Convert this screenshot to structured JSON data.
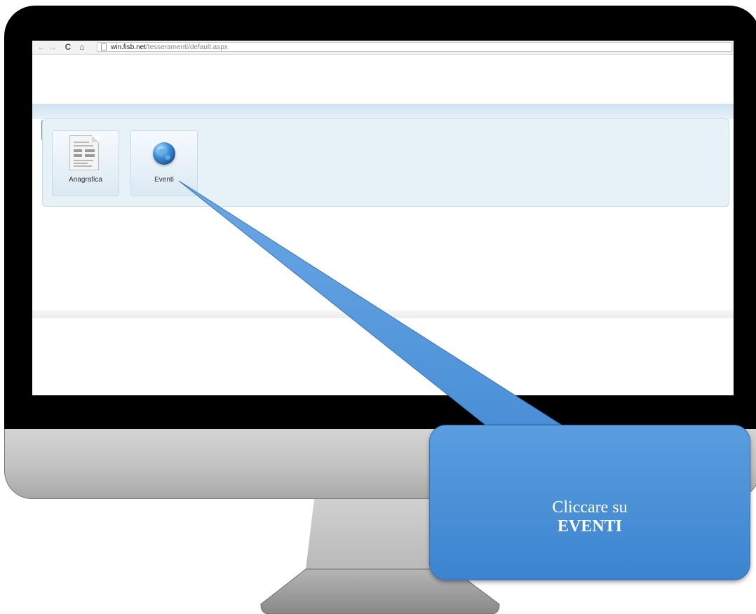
{
  "browser": {
    "back_icon": "←",
    "forward_icon": "→",
    "reload_icon": "C",
    "home_icon": "⌂",
    "url_domain": "win.fisb.net",
    "url_path": "/tesseramenti/default.aspx"
  },
  "tiles": [
    {
      "label": "Anagrafica",
      "icon": "document-icon"
    },
    {
      "label": "Eventi",
      "icon": "globe-icon"
    }
  ],
  "callout": {
    "line1": "Cliccare su",
    "line2": "EVENTI"
  },
  "colors": {
    "callout_fill": "#4a90d9",
    "panel_background": "#e6f1f8",
    "monitor_bezel": "#000000"
  }
}
